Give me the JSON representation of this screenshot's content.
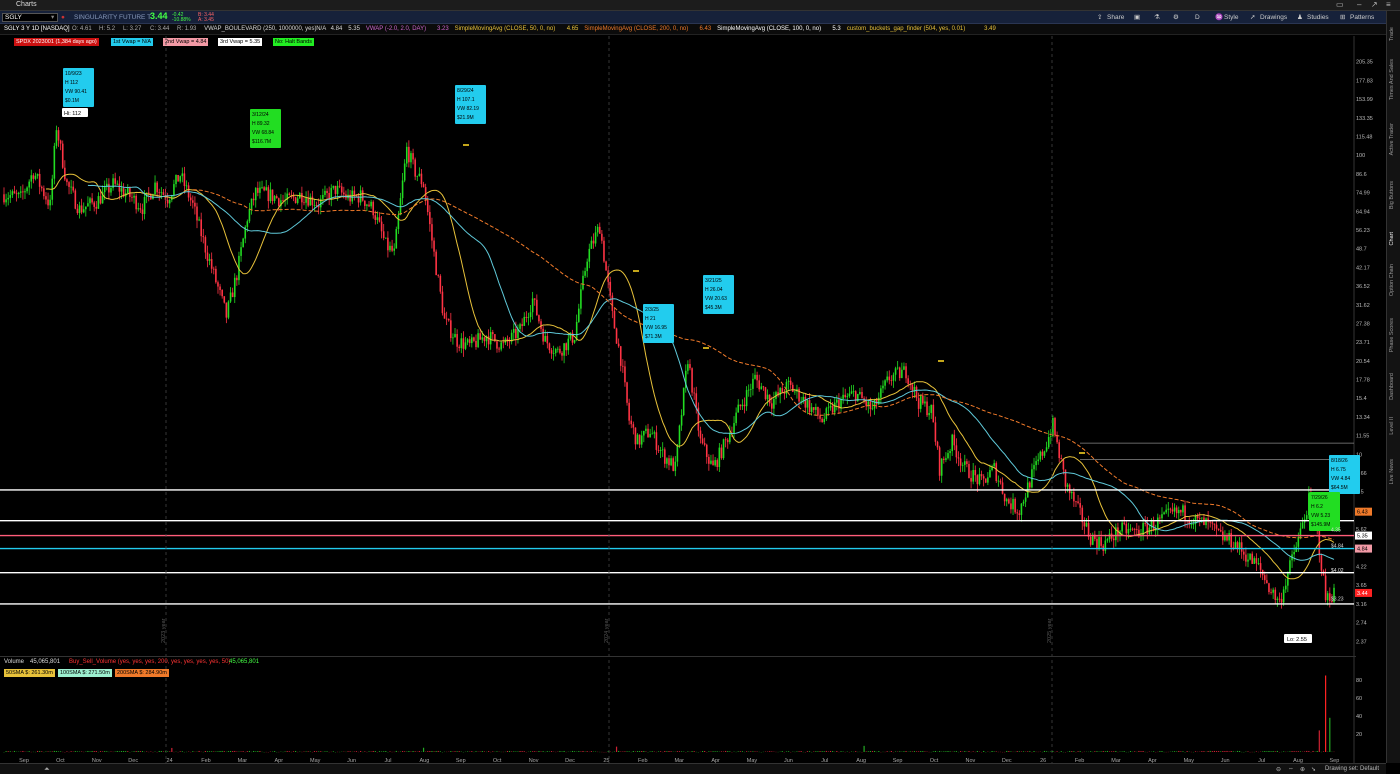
{
  "window": {
    "title": "Charts"
  },
  "toolbar": {
    "symbol": "SGLY",
    "company": "SINGULARITY FUTURE T",
    "last": "3.44",
    "change": "-0.42",
    "change_pct": "-10.88%",
    "bid": "B: 3.44",
    "ask": "A: 3.45",
    "share": "Share",
    "period": "D",
    "style": "Style",
    "drawings": "Drawings",
    "studies": "Studies",
    "patterns": "Patterns"
  },
  "studybar": {
    "items": [
      {
        "text": "SGLY 3 Y 1D [NASDAQ]",
        "color": "#ffffff"
      },
      {
        "text": "O: 4.61",
        "color": "#aaaaaa"
      },
      {
        "text": "H: 5.2",
        "color": "#aaaaaa"
      },
      {
        "text": "L: 3.27",
        "color": "#aaaaaa"
      },
      {
        "text": "C: 3.44",
        "color": "#aaaaaa"
      },
      {
        "text": "R: 1.93",
        "color": "#aaaaaa"
      },
      {
        "text": "VWAP_BOULEVARD (250, 1000000, yes)",
        "color": "#d9d9d9"
      },
      {
        "text": "N/A",
        "color": "#d9d9d9"
      },
      {
        "text": "4.84",
        "color": "#d9d9d9"
      },
      {
        "text": "5.35",
        "color": "#d9d9d9"
      },
      {
        "text": "VWAP (-2.0, 2.0, DAY)",
        "color": "#cc66cc"
      },
      {
        "text": "3.23",
        "color": "#cc66cc"
      },
      {
        "text": "SimpleMovingAvg (CLOSE, 50, 0, no)",
        "color": "#e8c23a"
      },
      {
        "text": "4.65",
        "color": "#e8c23a"
      },
      {
        "text": "SimpleMovingAvg (CLOSE, 200, 0, no)",
        "color": "#f07a2a"
      },
      {
        "text": "6.43",
        "color": "#f07a2a"
      },
      {
        "text": "SimpleMovingAvg (CLOSE, 100, 0, no)",
        "color": "#ffffff"
      },
      {
        "text": "5.3",
        "color": "#ffffff"
      },
      {
        "text": "custom_buckets_gap_finder (504, yes, 0.01)",
        "color": "#e8c23a"
      },
      {
        "text": "3.49",
        "color": "#e8c23a"
      }
    ]
  },
  "pills": [
    {
      "text": "SPDX 2023001 (1,384 days ago)",
      "bg": "#cc1111",
      "fg": "#ffffff"
    },
    {
      "text": "1st Vwap = N/A",
      "bg": "#22ccee",
      "fg": "#000000"
    },
    {
      "text": "2nd Vwap = 4.84",
      "bg": "#f39aa6",
      "fg": "#000000"
    },
    {
      "text": "3rd Vwap = 5.35",
      "bg": "#ffffff",
      "fg": "#000000"
    },
    {
      "text": "No: Halt Bands",
      "bg": "#22ee22",
      "fg": "#000000"
    }
  ],
  "chart_data": [
    {
      "type": "candlestick",
      "title": "SGLY 3 Y 1D [NASDAQ]",
      "y_scale": "log",
      "ylim": [
        2.2,
        230
      ],
      "y_ticks": [
        "205.35",
        "177.83",
        "153.99",
        "133.35",
        "115.48",
        "100",
        "86.6",
        "74.99",
        "64.94",
        "56.23",
        "48.7",
        "42.17",
        "36.52",
        "31.62",
        "27.38",
        "23.71",
        "20.54",
        "17.78",
        "15.4",
        "13.34",
        "11.55",
        "10",
        "8.66",
        "7.5",
        "6.49",
        "5.62",
        "4.87",
        "4.22",
        "3.65",
        "3.16",
        "2.74",
        "2.37"
      ],
      "x_ticks": [
        "Sep",
        "Oct",
        "Nov",
        "Dec",
        "24",
        "Feb",
        "Mar",
        "Apr",
        "May",
        "Jun",
        "Jul",
        "Aug",
        "Sep",
        "Oct",
        "Nov",
        "Dec",
        "25",
        "Feb",
        "Mar",
        "Apr",
        "May",
        "Jun",
        "Jul",
        "Aug",
        "Sep",
        "Oct",
        "Nov",
        "Dec",
        "26",
        "Feb",
        "Mar",
        "Apr",
        "May",
        "Jun",
        "Jul",
        "Aug",
        "Sep"
      ],
      "year_labels": [
        "2023 year",
        "2024 year",
        "2025 year"
      ],
      "hi_label": "Hi: 112",
      "lo_label": "Lo: 2.55",
      "price_path": [
        [
          0,
          74
        ],
        [
          8,
          72
        ],
        [
          14,
          88
        ],
        [
          22,
          68
        ],
        [
          25,
          125
        ],
        [
          30,
          80
        ],
        [
          36,
          66
        ],
        [
          44,
          70
        ],
        [
          52,
          80
        ],
        [
          60,
          73
        ],
        [
          66,
          67
        ],
        [
          72,
          80
        ],
        [
          78,
          72
        ],
        [
          84,
          86
        ],
        [
          90,
          68
        ],
        [
          96,
          49
        ],
        [
          102,
          36
        ],
        [
          106,
          29
        ],
        [
          111,
          40
        ],
        [
          116,
          62
        ],
        [
          120,
          75
        ],
        [
          126,
          74
        ],
        [
          134,
          70
        ],
        [
          142,
          74
        ],
        [
          150,
          69
        ],
        [
          158,
          77
        ],
        [
          164,
          72
        ],
        [
          170,
          73
        ],
        [
          176,
          66
        ],
        [
          182,
          50
        ],
        [
          186,
          47
        ],
        [
          192,
          105
        ],
        [
          196,
          88
        ],
        [
          200,
          80
        ],
        [
          206,
          42
        ],
        [
          210,
          28
        ],
        [
          216,
          24
        ],
        [
          222,
          23
        ],
        [
          230,
          25
        ],
        [
          238,
          23
        ],
        [
          246,
          26
        ],
        [
          252,
          33
        ],
        [
          258,
          24
        ],
        [
          264,
          22
        ],
        [
          272,
          25
        ],
        [
          278,
          46
        ],
        [
          284,
          58
        ],
        [
          290,
          29
        ],
        [
          294,
          21
        ],
        [
          298,
          13
        ],
        [
          302,
          11
        ],
        [
          308,
          12
        ],
        [
          314,
          10
        ],
        [
          320,
          9
        ],
        [
          326,
          21
        ],
        [
          332,
          11
        ],
        [
          338,
          9
        ],
        [
          344,
          11
        ],
        [
          350,
          14
        ],
        [
          358,
          18
        ],
        [
          366,
          15
        ],
        [
          374,
          17
        ],
        [
          382,
          15
        ],
        [
          390,
          13
        ],
        [
          398,
          15
        ],
        [
          406,
          16
        ],
        [
          414,
          14
        ],
        [
          422,
          18
        ],
        [
          430,
          19
        ],
        [
          436,
          15
        ],
        [
          442,
          14
        ],
        [
          446,
          9
        ],
        [
          452,
          11
        ],
        [
          458,
          9
        ],
        [
          466,
          8
        ],
        [
          472,
          9
        ],
        [
          478,
          7
        ],
        [
          484,
          6.5
        ],
        [
          490,
          8.5
        ],
        [
          496,
          10.5
        ],
        [
          500,
          12.5
        ],
        [
          506,
          8
        ],
        [
          512,
          6.5
        ],
        [
          518,
          5.3
        ],
        [
          524,
          5
        ],
        [
          532,
          5.6
        ],
        [
          540,
          5.5
        ],
        [
          548,
          5.8
        ],
        [
          556,
          6.3
        ],
        [
          562,
          6.4
        ],
        [
          568,
          6
        ],
        [
          574,
          5.8
        ],
        [
          580,
          5.3
        ],
        [
          586,
          5.1
        ],
        [
          592,
          4.6
        ],
        [
          598,
          4.2
        ],
        [
          604,
          3.5
        ],
        [
          608,
          3.2
        ],
        [
          612,
          4
        ],
        [
          618,
          5.5
        ],
        [
          622,
          7
        ],
        [
          626,
          5.5
        ],
        [
          630,
          3.3
        ],
        [
          634,
          3.44
        ]
      ],
      "highlights": [
        {
          "date": "10/9/23",
          "h": "H 112",
          "vw": "VW 90.41",
          "vol": "$0.1M",
          "color": "#22ccee"
        },
        {
          "date": "3/12/24",
          "h": "H 89.32",
          "vw": "VW 68.84",
          "vol": "$116.7M",
          "color": "#22dd22"
        },
        {
          "date": "8/29/24",
          "h": "H 107.1",
          "vw": "VW 82.19",
          "vol": "$21.9M",
          "color": "#22ccee"
        },
        {
          "date": "2/3/25",
          "h": "H 21",
          "vw": "VW 16.95",
          "vol": "$71.3M",
          "color": "#22ccee"
        },
        {
          "date": "3/21/25",
          "h": "H 26.04",
          "vw": "VW 20.63",
          "vol": "$45.3M",
          "color": "#22ccee"
        },
        {
          "date": "8/18/26",
          "h": "H 6.75",
          "vw": "VW 4.84",
          "vol": "$64.5M",
          "color": "#22ccee"
        },
        {
          "date": "7/29/26",
          "h": "H 6.2",
          "vw": "VW 5.23",
          "vol": "$145.9M",
          "color": "#22dd22"
        }
      ],
      "levels": [
        {
          "value": 10.9,
          "color": "#888888"
        },
        {
          "value": 9.6,
          "color": "#888888"
        },
        {
          "value": 7.6,
          "color": "#ffffff"
        },
        {
          "value": 6.0,
          "color": "#ffffff"
        },
        {
          "value": 5.35,
          "color": "#ff5c7a"
        },
        {
          "value": 4.84,
          "color": "#22ccee"
        },
        {
          "value": 4.02,
          "color": "#ffffff"
        },
        {
          "value": 3.16,
          "color": "#ffffff"
        }
      ],
      "price_tags": [
        {
          "text": "6.43",
          "value": 6.43,
          "bg": "#f07a2a",
          "fg": "#000000"
        },
        {
          "text": "5.35",
          "value": 5.35,
          "bg": "#ffffff",
          "fg": "#000000"
        },
        {
          "text": "4.84",
          "value": 4.84,
          "bg": "#f39aa6",
          "fg": "#000000"
        },
        {
          "text": "3.44",
          "value": 3.44,
          "bg": "#ff2222",
          "fg": "#ffffff"
        }
      ],
      "inline_values": [
        {
          "text": "4.35",
          "value": 5.6
        },
        {
          "text": "$4.84",
          "value": 4.95
        },
        {
          "text": "$4.02",
          "value": 4.1
        },
        {
          "text": "$3.23",
          "value": 3.3
        }
      ]
    },
    {
      "type": "bar",
      "title": "Volume",
      "value_text": "45,065,801",
      "y_ticks": [
        "80",
        "60",
        "40",
        "20"
      ],
      "ylim": [
        0,
        90
      ]
    }
  ],
  "volhead": {
    "label": "Volume",
    "value": "45,065,801",
    "study": "Buy_Sell_Volume (yes, yes, yes, 200, yes, yes, yes, yes, 50)",
    "study_value": "45,065,801"
  },
  "volpills": [
    {
      "text": "50SMA $: 261.30m",
      "bg": "#e8c23a"
    },
    {
      "text": "100SMA $: 271.50m",
      "bg": "#9cf0d0"
    },
    {
      "text": "200SMA $: 284.90m",
      "bg": "#f07a2a"
    }
  ],
  "right_tabs": [
    "Trade",
    "Times And Sales",
    "Active Trader",
    "Big Buttons",
    "Chart",
    "Option Chain",
    "Phase Scores",
    "Dashboard",
    "Level II",
    "Live News"
  ],
  "bottombar": {
    "drawing_set": "Drawing set: Default"
  }
}
